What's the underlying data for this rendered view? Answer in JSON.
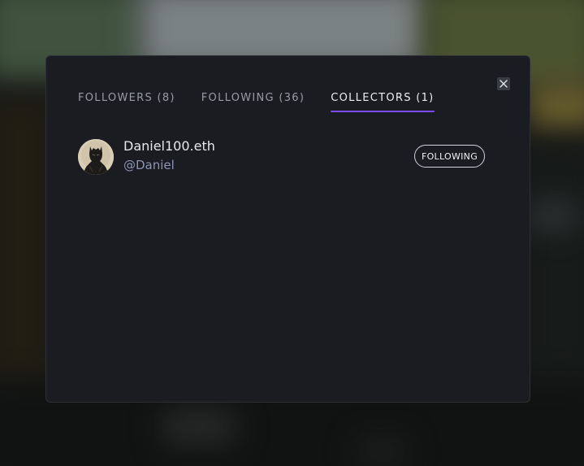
{
  "tabs": [
    {
      "label": "FOLLOWERS (8)",
      "active": false
    },
    {
      "label": "FOLLOWING (36)",
      "active": false
    },
    {
      "label": "COLLECTORS (1)",
      "active": true
    }
  ],
  "close_icon": "close-icon",
  "accent_color": "#7b4cf2",
  "collectors": [
    {
      "name": "Daniel100.eth",
      "handle": "@Daniel",
      "avatar_icon": "avatar",
      "button_label": "FOLLOWING"
    }
  ]
}
